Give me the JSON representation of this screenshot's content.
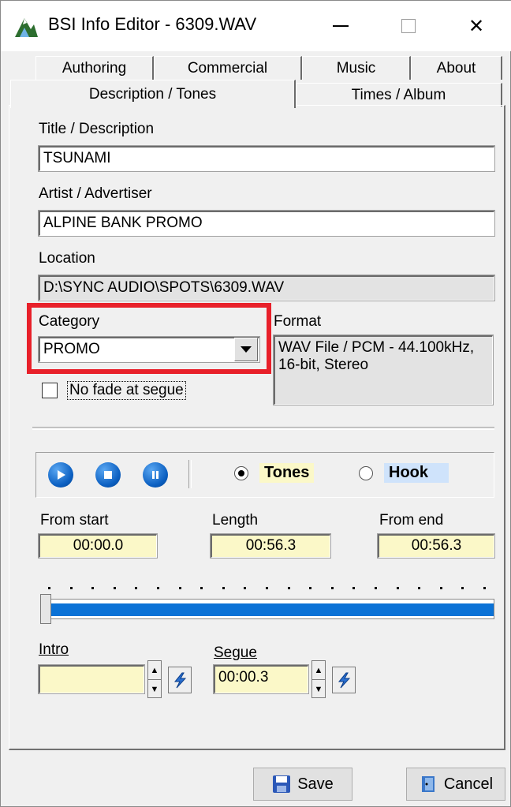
{
  "window": {
    "title": "BSI Info Editor - 6309.WAV"
  },
  "titlebar": {
    "minimize_glyph": "—",
    "close_glyph": "✕"
  },
  "tabs": {
    "row1": [
      "Authoring",
      "Commercial",
      "Music",
      "About"
    ],
    "row2": [
      "Description / Tones",
      "Times / Album"
    ],
    "active": "Description / Tones"
  },
  "fields": {
    "title": {
      "label": "Title / Description",
      "value": "TSUNAMI"
    },
    "artist": {
      "label": "Artist / Advertiser",
      "value": "ALPINE BANK PROMO"
    },
    "location": {
      "label": "Location",
      "value": "D:\\SYNC AUDIO\\SPOTS\\6309.WAV"
    },
    "category": {
      "label": "Category",
      "value": "PROMO"
    },
    "format": {
      "label": "Format",
      "value": "WAV File / PCM - 44.100kHz, 16-bit, Stereo"
    }
  },
  "no_fade": {
    "label": "No fade at segue",
    "checked": false
  },
  "playback": {
    "play_icon": "play-icon",
    "stop_icon": "stop-icon",
    "pause_icon": "pause-icon",
    "modes": [
      {
        "label": "Tones",
        "selected": true
      },
      {
        "label": "Hook",
        "selected": false
      }
    ]
  },
  "times": {
    "from_start": {
      "label": "From start",
      "value": "00:00.0"
    },
    "length": {
      "label": "Length",
      "value": "00:56.3"
    },
    "from_end": {
      "label": "From end",
      "value": "00:56.3"
    }
  },
  "markers": {
    "intro": {
      "label": "Intro",
      "value": ""
    },
    "segue": {
      "label": "Segue",
      "value": "00:00.3"
    }
  },
  "buttons": {
    "save": "Save",
    "cancel": "Cancel"
  },
  "colors": {
    "highlight": "#e8202a",
    "yellow_field": "#fbf8c8",
    "hook_bg": "#cfe3fb",
    "progress": "#0b72d6"
  }
}
